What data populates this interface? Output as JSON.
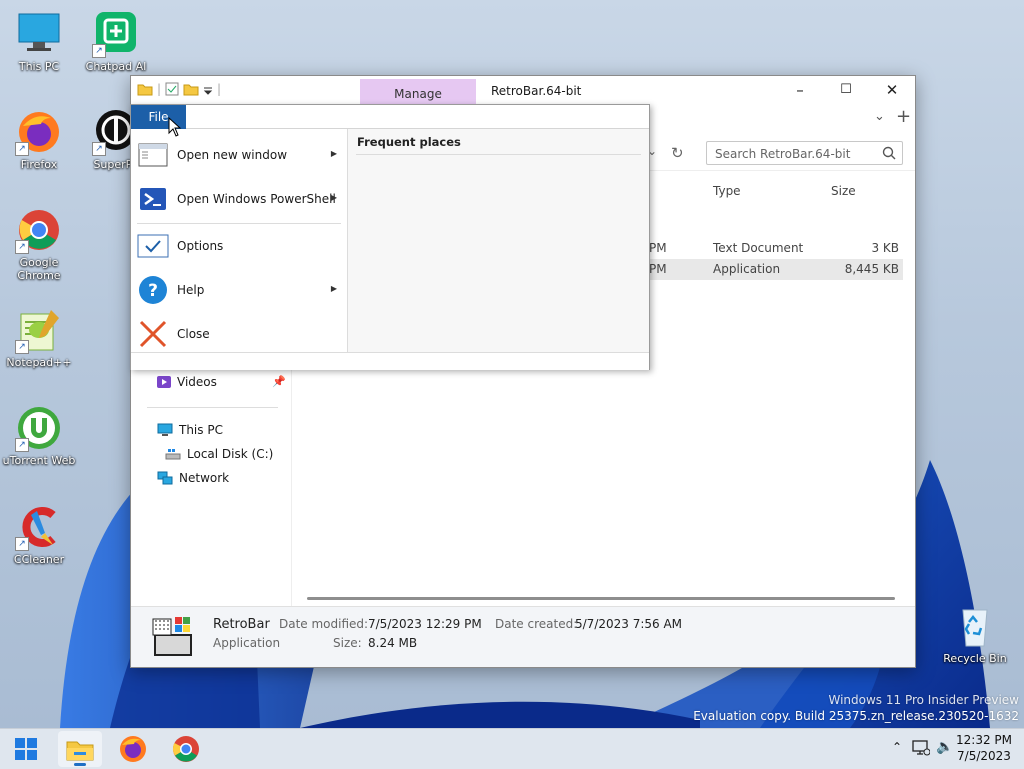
{
  "desktop_icons": [
    {
      "label": "This PC",
      "icon": "monitor-icon"
    },
    {
      "label": "Chatpad AI",
      "icon": "chatpad-icon"
    },
    {
      "label": "Firefox",
      "icon": "firefox-icon"
    },
    {
      "label": "SuperPa",
      "icon": "superpa-icon"
    },
    {
      "label": "Google Chrome",
      "icon": "chrome-icon"
    },
    {
      "label": "Notepad++",
      "icon": "notepadpp-icon"
    },
    {
      "label": "uTorrent Web",
      "icon": "utorrent-icon"
    },
    {
      "label": "CCleaner",
      "icon": "ccleaner-icon"
    },
    {
      "label": "Recycle Bin",
      "icon": "recycle-bin-icon"
    }
  ],
  "watermark": {
    "line1": "Windows 11 Pro Insider Preview",
    "line2": "Evaluation copy. Build 25375.zn_release.230520-1632"
  },
  "explorer": {
    "title": "RetroBar.64-bit",
    "manage_tab": "Manage",
    "search_placeholder": "Search RetroBar.64-bit",
    "columns": {
      "type": "Type",
      "size": "Size"
    },
    "rows": [
      {
        "time_fragment": "PM",
        "type": "Text Document",
        "size": "3 KB"
      },
      {
        "time_fragment": "PM",
        "type": "Application",
        "size": "8,445 KB"
      }
    ],
    "nav": {
      "videos": "Videos",
      "this_pc": "This PC",
      "local_disk": "Local Disk (C:)",
      "network": "Network"
    },
    "details": {
      "name": "RetroBar",
      "kind": "Application",
      "date_modified_label": "Date modified:",
      "date_modified": "7/5/2023 12:29 PM",
      "size_label": "Size:",
      "size": "8.24 MB",
      "date_created_label": "Date created:",
      "date_created": "5/7/2023 7:56 AM"
    }
  },
  "file_menu": {
    "tab": "File",
    "items": [
      {
        "label": "Open new window",
        "submenu": true
      },
      {
        "label": "Open Windows PowerShell",
        "submenu": true
      },
      {
        "label": "Options",
        "submenu": false
      },
      {
        "label": "Help",
        "submenu": true
      },
      {
        "label": "Close",
        "submenu": false
      }
    ],
    "frequent_places": "Frequent places"
  },
  "taskbar": {
    "time": "12:32 PM",
    "date": "7/5/2023"
  },
  "colors": {
    "accent": "#1c5fa8",
    "manage_tab": "#e6c8f2"
  }
}
